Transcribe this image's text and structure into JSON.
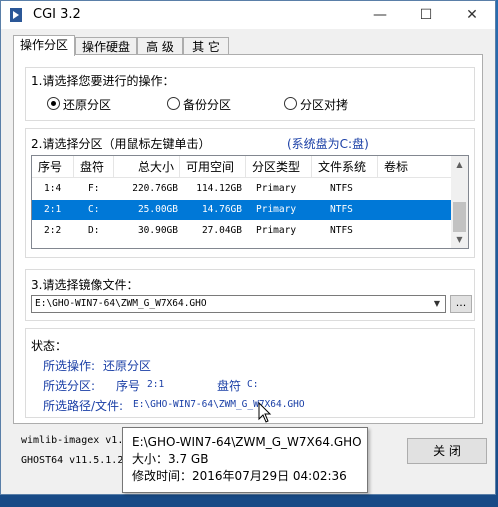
{
  "window": {
    "title": "CGI 3.2",
    "controls": [
      "—",
      "☐",
      "✕"
    ]
  },
  "tabs": [
    "操作分区",
    "操作硬盘",
    "高 级",
    "其 它"
  ],
  "operation": {
    "label": "1.请选择您要进行的操作：",
    "options": [
      {
        "label": "还原分区",
        "checked": true
      },
      {
        "label": "备份分区",
        "checked": false
      },
      {
        "label": "分区对拷",
        "checked": false
      }
    ]
  },
  "partition": {
    "label": "2.请选择分区（用鼠标左键单击）",
    "system_hint": "(系统盘为C:盘)",
    "headers": [
      "序号",
      "盘符",
      "总大小",
      "可用空间",
      "分区类型",
      "文件系统",
      "卷标"
    ],
    "rows": [
      {
        "index": "1:4",
        "letter": "F:",
        "total": "220.76GB",
        "free": "114.12GB",
        "type": "Primary",
        "fs": "NTFS",
        "label": "",
        "selected": false
      },
      {
        "index": "2:1",
        "letter": "C:",
        "total": "25.00GB",
        "free": "14.76GB",
        "type": "Primary",
        "fs": "NTFS",
        "label": "",
        "selected": true
      },
      {
        "index": "2:2",
        "letter": "D:",
        "total": "30.90GB",
        "free": "27.04GB",
        "type": "Primary",
        "fs": "NTFS",
        "label": "",
        "selected": false
      }
    ]
  },
  "image": {
    "label": "3.请选择镜像文件：",
    "path": "E:\\GHO-WIN7-64\\ZWM_G_W7X64.GHO",
    "browse_label": "..."
  },
  "status": {
    "title": "状态：",
    "op_label": "所选操作:",
    "op_value": "还原分区",
    "part_label": "所选分区:",
    "part_index_label": "序号",
    "part_index": "2:1",
    "part_letter_label": "盘符",
    "part_letter": "C:",
    "path_label": "所选路径/文件:",
    "path_value": "E:\\GHO-WIN7-64\\ZWM_G_W7X64.GHO"
  },
  "footer": {
    "line1": "wimlib-imagex v1.",
    "line2": "GHOST64 v11.5.1.2",
    "close_label": "关 闭"
  },
  "tooltip": {
    "path": "E:\\GHO-WIN7-64\\ZWM_G_W7X64.GHO",
    "size_label": "大小：",
    "size": "3.7 GB",
    "modified_label": "修改时间：",
    "modified": "2016年07月29日 04:02:36"
  }
}
